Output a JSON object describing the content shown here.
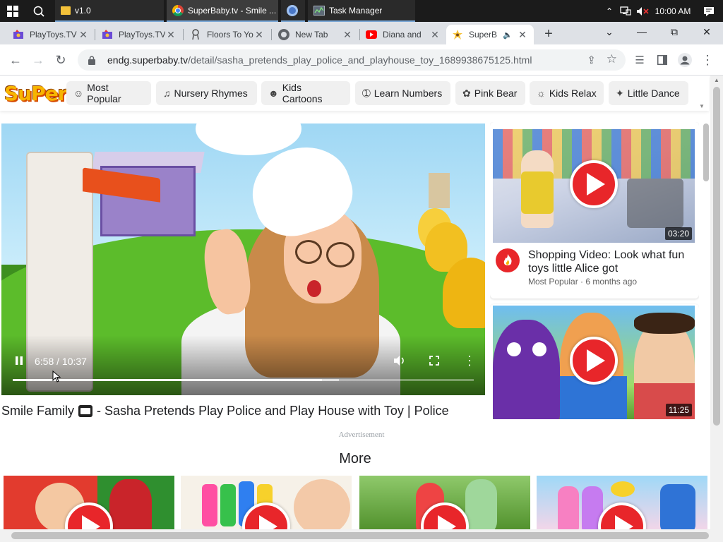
{
  "taskbar": {
    "apps": [
      {
        "label": "v1.0",
        "icon": "folder-icon"
      },
      {
        "label": "SuperBaby.tv - Smile ...",
        "icon": "chrome-icon"
      },
      {
        "label": "",
        "icon": "chrome-icon"
      },
      {
        "label": "Task Manager",
        "icon": "task-manager-icon"
      }
    ],
    "time": "10:00 AM"
  },
  "tabs": [
    {
      "title": "PlayToys.TV",
      "icon": "playtoys-favicon"
    },
    {
      "title": "PlayToys.TV",
      "icon": "playtoys-favicon"
    },
    {
      "title": "Floors To Yo",
      "icon": "floors-favicon"
    },
    {
      "title": "New Tab",
      "icon": "chrome-icon"
    },
    {
      "title": "Diana and",
      "icon": "youtube-icon"
    },
    {
      "title": "SuperB",
      "icon": "superbaby-favicon"
    }
  ],
  "address": {
    "host": "endg.superbaby.tv",
    "path": "/detail/sasha_pretends_play_police_and_playhouse_toy_1689938675125.html"
  },
  "site": {
    "logo": "SuPer",
    "categories": [
      {
        "label": "Most Popular",
        "icon": "smile-icon"
      },
      {
        "label": "Nursery Rhymes",
        "icon": "music-icon"
      },
      {
        "label": "Kids Cartoons",
        "icon": "cartoon-icon"
      },
      {
        "label": "Learn Numbers",
        "icon": "numbers-icon"
      },
      {
        "label": "Pink Bear",
        "icon": "paw-icon"
      },
      {
        "label": "Kids Relax",
        "icon": "relax-icon"
      },
      {
        "label": "Little Dance",
        "icon": "dance-icon"
      }
    ]
  },
  "player": {
    "time_display": "6:58 / 10:37",
    "played_fraction": 0.67,
    "buffered_fraction": 0.708
  },
  "video": {
    "title_before": "Smile Family",
    "title_after": "- Sasha Pretends Play Police and Play House with Toy | Police"
  },
  "sidebar": {
    "cards": [
      {
        "title": "Shopping Video: Look what fun toys little Alice got",
        "category": "Most Popular",
        "age": "6 months ago",
        "duration": "03:20"
      },
      {
        "duration": "11:25"
      }
    ]
  },
  "advertisement_label": "Advertisement",
  "more_heading": "More",
  "colors": {
    "accent_red": "#e8262a",
    "chrome_tabstrip": "#dee1e6",
    "taskbar": "#1b1b1b"
  }
}
